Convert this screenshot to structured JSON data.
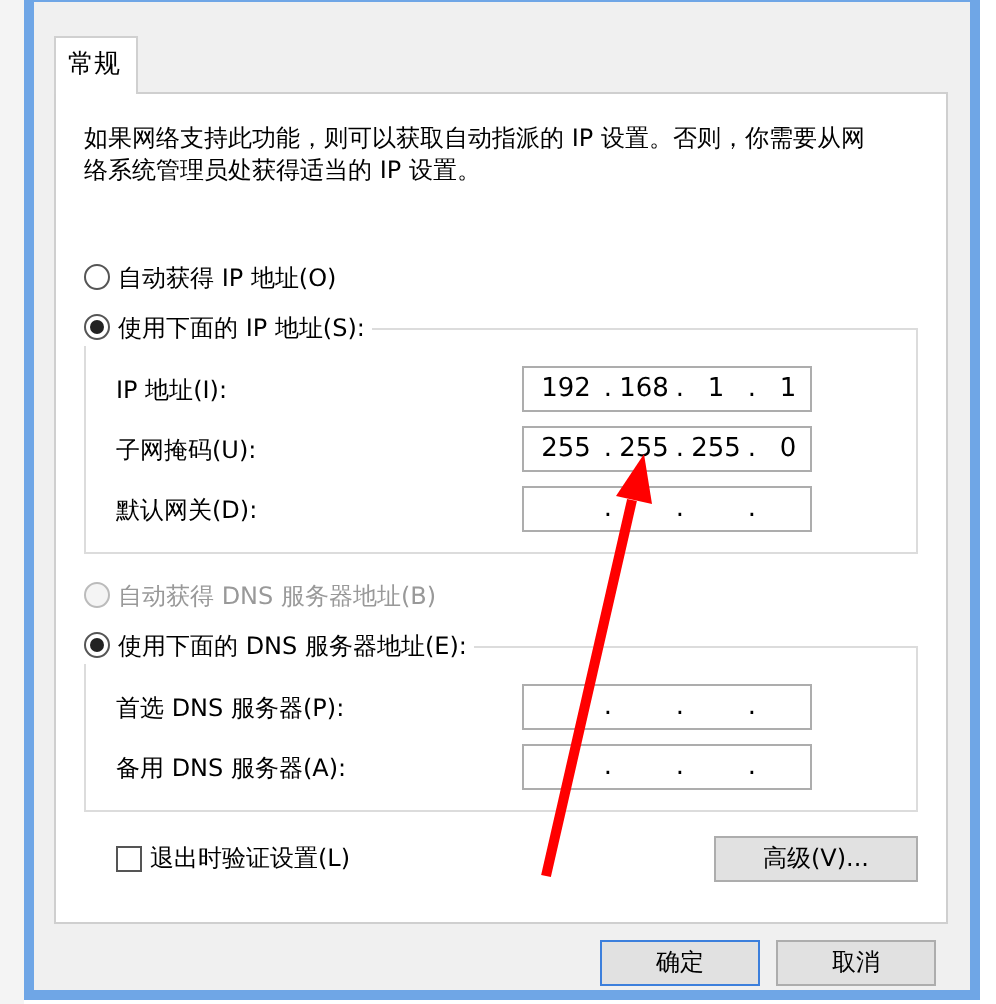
{
  "tabs": [
    {
      "label": "常规",
      "selected": true
    }
  ],
  "description": "如果网络支持此功能，则可以获取自动指派的 IP 设置。否则，你需要从网络系统管理员处获得适当的 IP 设置。",
  "ip_section": {
    "options": [
      {
        "label": "自动获得 IP 地址(O)",
        "selected": false,
        "disabled": false
      },
      {
        "label": "使用下面的 IP 地址(S):",
        "selected": true,
        "disabled": false
      }
    ],
    "fields": [
      {
        "label": "IP 地址(I):",
        "octets": [
          "192",
          "168",
          "1",
          "1"
        ]
      },
      {
        "label": "子网掩码(U):",
        "octets": [
          "255",
          "255",
          "255",
          "0"
        ]
      },
      {
        "label": "默认网关(D):"
      }
    ]
  },
  "dns_section": {
    "options": [
      {
        "label": "自动获得 DNS 服务器地址(B)",
        "selected": false,
        "disabled": true
      },
      {
        "label": "使用下面的 DNS 服务器地址(E):",
        "selected": true,
        "disabled": false
      }
    ],
    "fields": [
      {
        "label": "首选 DNS 服务器(P):"
      },
      {
        "label": "备用 DNS 服务器(A):"
      }
    ]
  },
  "separator": ".",
  "validate_checkbox": {
    "label": "退出时验证设置(L)",
    "checked": false
  },
  "advanced_button": "高级(V)...",
  "buttons": [
    {
      "label": "确定",
      "default": true
    },
    {
      "label": "取消",
      "default": false
    }
  ]
}
